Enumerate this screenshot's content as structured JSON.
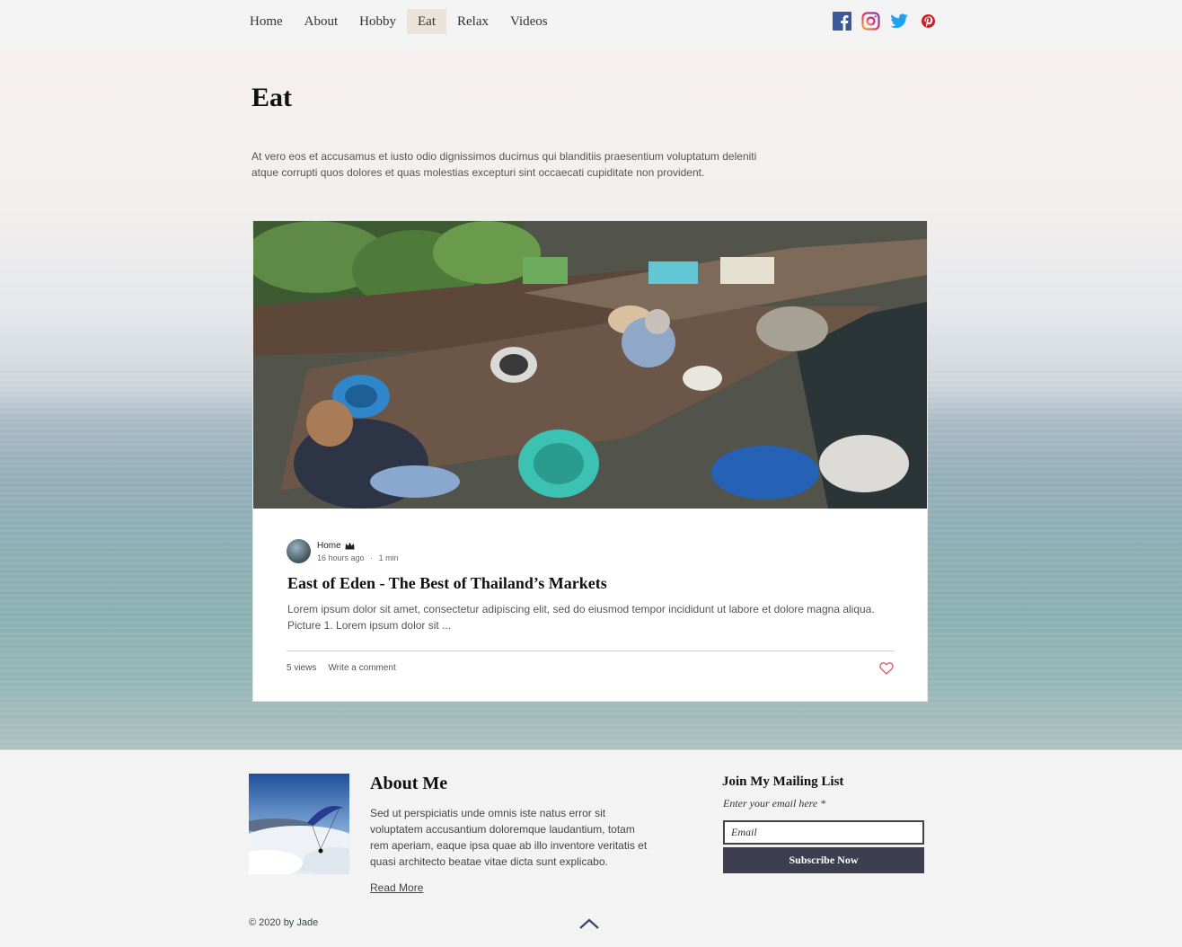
{
  "nav": {
    "items": [
      {
        "label": "Home"
      },
      {
        "label": "About"
      },
      {
        "label": "Hobby"
      },
      {
        "label": "Eat"
      },
      {
        "label": "Relax"
      },
      {
        "label": "Videos"
      }
    ],
    "active": "Eat",
    "social_icons": [
      "facebook-icon",
      "instagram-icon",
      "twitter-icon",
      "pinterest-icon"
    ]
  },
  "header": {
    "title": "Eat",
    "description": "At vero eos et accusamus et iusto odio dignissimos ducimus qui blanditiis praesentium voluptatum deleniti atque corrupti quos dolores et quas molestias excepturi sint occaecati cupiditate non provident."
  },
  "post": {
    "author": "Home",
    "time": "16 hours ago",
    "read_time": "1 min",
    "separator": "·",
    "title": "East of Eden - The Best of Thailand’s Markets",
    "excerpt": "Lorem ipsum dolor sit amet, consectetur adipiscing elit, sed do eiusmod tempor incididunt ut labore et dolore magna aliqua. Picture 1. Lorem ipsum dolor sit ...",
    "views": "5 views",
    "comment_link": "Write a comment"
  },
  "footer": {
    "about_title": "About Me",
    "about_text": "Sed ut perspiciatis unde omnis iste natus error sit voluptatem accusantium doloremque laudantium, totam rem aperiam, eaque ipsa quae ab illo inventore veritatis et quasi architecto beatae vitae dicta sunt explicabo.",
    "read_more": "Read More",
    "mailing_title": "Join My Mailing List",
    "email_label": "Enter your email here *",
    "email_placeholder": "Email",
    "subscribe_label": "Subscribe Now",
    "copyright": "© 2020 by Jade"
  },
  "colors": {
    "accent_button": "#3d3f51",
    "nav_active_bg": "#e9e3da",
    "like_heart": "#e0555a"
  }
}
